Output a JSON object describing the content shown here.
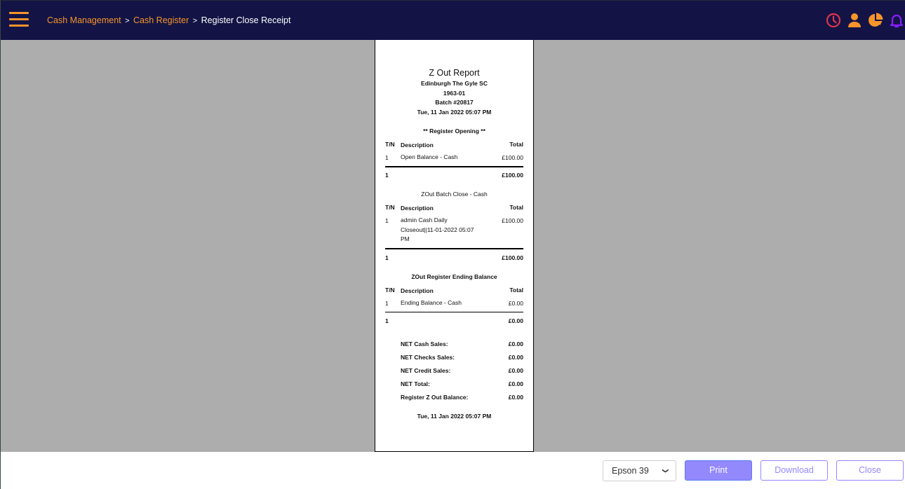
{
  "header": {
    "breadcrumb": [
      {
        "label": "Cash Management",
        "link": true
      },
      {
        "label": "Cash Register",
        "link": true
      },
      {
        "label": "Register Close Receipt",
        "link": false
      }
    ],
    "separator": ">",
    "icons": [
      "clock-icon",
      "user-icon",
      "pie-chart-icon",
      "bell-icon"
    ],
    "colors": {
      "bar": "#131445",
      "accent": "#f7942b",
      "clock": "#e0334a",
      "bell": "#8a1dff"
    }
  },
  "receipt": {
    "title": "Z Out Report",
    "store": "Edinburgh The Gyle SC",
    "register_id": "1963-01",
    "batch": "Batch #20817",
    "datetime": "Tue, 11 Jan 2022 05:07 PM",
    "columns": {
      "tn": "T/N",
      "description": "Description",
      "total": "Total"
    },
    "sections": [
      {
        "title": "** Register Opening **",
        "rows": [
          {
            "tn": "1",
            "description": "Open Balance - Cash",
            "total": "£100.00"
          }
        ],
        "summary": {
          "count": "1",
          "total": "£100.00"
        }
      },
      {
        "title": "ZOut Batch Close - Cash",
        "rows": [
          {
            "tn": "1",
            "description": "admin Cash Daily Closeout||11-01-2022 05:07 PM",
            "total": "£100.00"
          }
        ],
        "summary": {
          "count": "1",
          "total": "£100.00"
        }
      },
      {
        "title": "ZOut Register Ending Balance",
        "rows": [
          {
            "tn": "1",
            "description": "Ending Balance - Cash",
            "total": "£0.00"
          }
        ],
        "summary": {
          "count": "1",
          "total": "£0.00"
        }
      }
    ],
    "totals": [
      {
        "label": "NET Cash Sales:",
        "value": "£0.00"
      },
      {
        "label": "NET Checks Sales:",
        "value": "£0.00"
      },
      {
        "label": "NET Credit Sales:",
        "value": "£0.00"
      },
      {
        "label": "NET Total:",
        "value": "£0.00"
      },
      {
        "label": "Register Z Out Balance:",
        "value": "£0.00"
      }
    ],
    "footer_datetime": "Tue, 11 Jan 2022 05:07 PM"
  },
  "footer": {
    "printer_selected": "Epson 39",
    "print_label": "Print",
    "download_label": "Download",
    "close_label": "Close",
    "button_color": "#9488fd"
  }
}
